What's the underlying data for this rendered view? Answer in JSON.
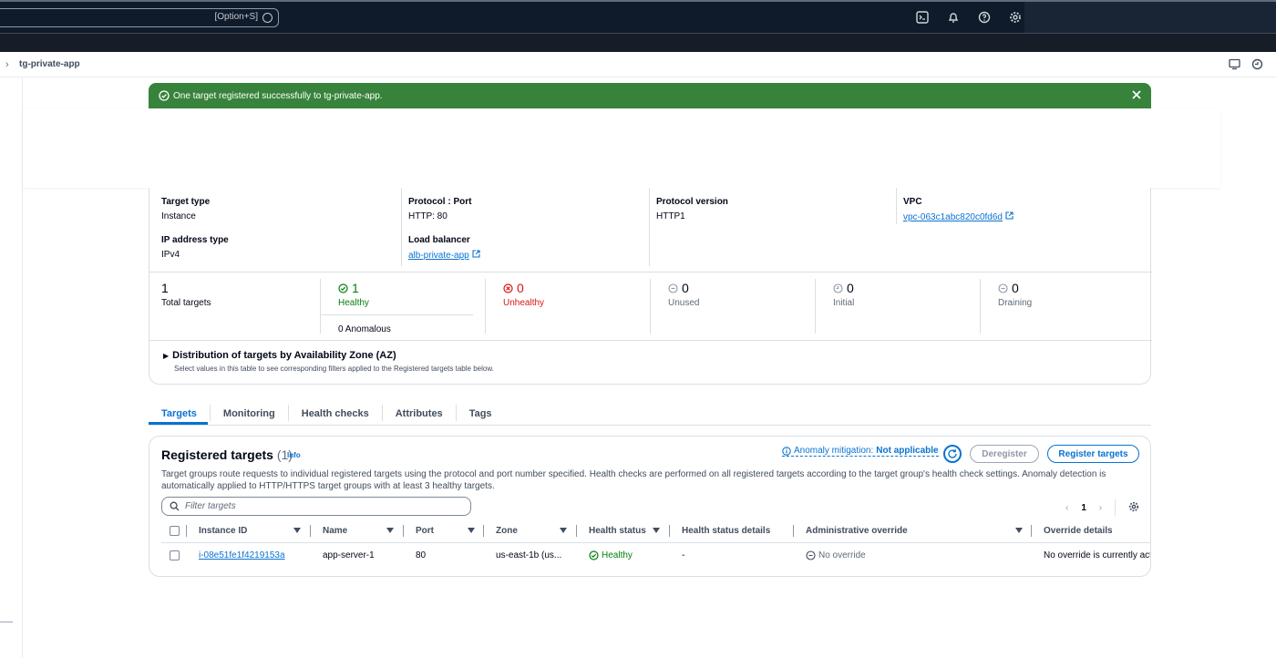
{
  "topbar": {
    "search_shortcut": "[Option+S]",
    "icons": [
      "cloudshell-icon",
      "bell-icon",
      "help-icon",
      "gear-icon"
    ]
  },
  "breadcrumb": {
    "current": "tg-private-app"
  },
  "flash": {
    "message": "One target registered successfully to tg-private-app.",
    "type": "success",
    "color": "#37833b"
  },
  "details": {
    "target_type": {
      "label": "Target type",
      "value": "Instance"
    },
    "protocol_port": {
      "label": "Protocol : Port",
      "value": "HTTP: 80"
    },
    "protocol_version": {
      "label": "Protocol version",
      "value": "HTTP1"
    },
    "vpc": {
      "label": "VPC",
      "value": "vpc-063c1abc820c0fd6d"
    },
    "ip_address_type": {
      "label": "IP address type",
      "value": "IPv4"
    },
    "load_balancer": {
      "label": "Load balancer",
      "value": "alb-private-app"
    }
  },
  "stats": {
    "total": {
      "value": "1",
      "label": "Total targets"
    },
    "healthy": {
      "value": "1",
      "label": "Healthy",
      "anomalous": "0 Anomalous"
    },
    "unhealthy": {
      "value": "0",
      "label": "Unhealthy"
    },
    "unused": {
      "value": "0",
      "label": "Unused"
    },
    "initial": {
      "value": "0",
      "label": "Initial"
    },
    "draining": {
      "value": "0",
      "label": "Draining"
    }
  },
  "distribution": {
    "title": "Distribution of targets by Availability Zone (AZ)",
    "description": "Select values in this table to see corresponding filters applied to the Registered targets table below."
  },
  "tabs": [
    "Targets",
    "Monitoring",
    "Health checks",
    "Attributes",
    "Tags"
  ],
  "active_tab": "Targets",
  "registered": {
    "title": "Registered targets",
    "count": "(1)",
    "info": "Info",
    "anomaly_label": "Anomaly mitigation:",
    "anomaly_value": "Not applicable",
    "deregister": "Deregister",
    "register": "Register targets",
    "description": "Target groups route requests to individual registered targets using the protocol and port number specified. Health checks are performed on all registered targets according to the target group's health check settings. Anomaly detection is automatically applied to HTTP/HTTPS target groups with at least 3 healthy targets.",
    "filter_placeholder": "Filter targets",
    "page": "1",
    "columns": [
      "Instance ID",
      "Name",
      "Port",
      "Zone",
      "Health status",
      "Health status details",
      "Administrative override",
      "Override details"
    ],
    "rows": [
      {
        "instance_id": "i-08e51fe1f4219153a",
        "name": "app-server-1",
        "port": "80",
        "zone": "us-east-1b (us...",
        "health_status": "Healthy",
        "health_details": "-",
        "admin_override": "No override",
        "override_details": "No override is currently acti"
      }
    ]
  }
}
